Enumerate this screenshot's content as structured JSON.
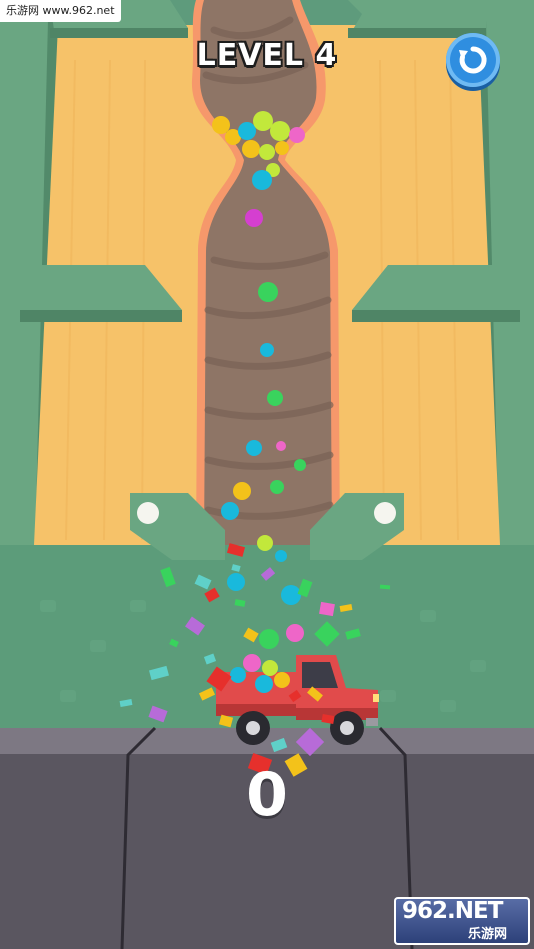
{
  "watermark": {
    "top_left": "乐游网 www.962.net",
    "brand_number": "962",
    "brand_suffix": ".NET",
    "brand_cn": "乐游网"
  },
  "hud": {
    "level_label": "LEVEL 4",
    "score": "0"
  },
  "icons": {
    "restart": "restart-icon"
  },
  "colors": {
    "sand": "#f6c269",
    "dirt": "#8e7566",
    "wall_green": "#6aa682",
    "ground_green": "#5c9c7a",
    "road": "#5a5660",
    "truck": "#e14b4b",
    "restart_button": "#2f8ee0",
    "ball_palette": [
      "#f3c21a",
      "#c2e83b",
      "#19b9dc",
      "#d53fd0",
      "#39d35d",
      "#ee66c8"
    ]
  }
}
